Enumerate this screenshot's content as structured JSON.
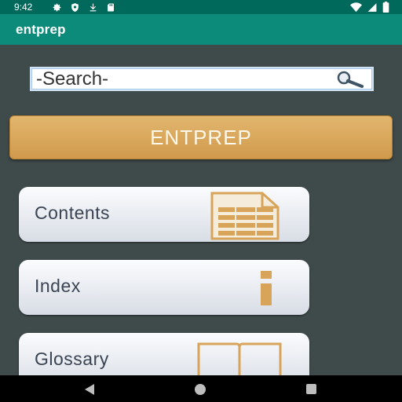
{
  "status_bar": {
    "time": "9:42",
    "left_icons": [
      "gear-icon",
      "shield-icon",
      "download-icon",
      "sd-card-icon"
    ],
    "right_icons": [
      "wifi-icon",
      "signal-icon",
      "battery-icon"
    ]
  },
  "app_bar": {
    "title": "entprep"
  },
  "search": {
    "placeholder": "-Search-"
  },
  "banner": {
    "label": "ENTPREP"
  },
  "menu": {
    "items": [
      {
        "label": "Contents",
        "icon": "document-list-icon"
      },
      {
        "label": "Index",
        "icon": "info-icon"
      },
      {
        "label": "Glossary",
        "icon": "open-book-icon"
      }
    ]
  },
  "colors": {
    "status_bar": "#00695c",
    "app_bar": "#0c8a7a",
    "background": "#3f4a4a",
    "banner": "#d9a95e",
    "icon_gold": "#d7a45a"
  }
}
